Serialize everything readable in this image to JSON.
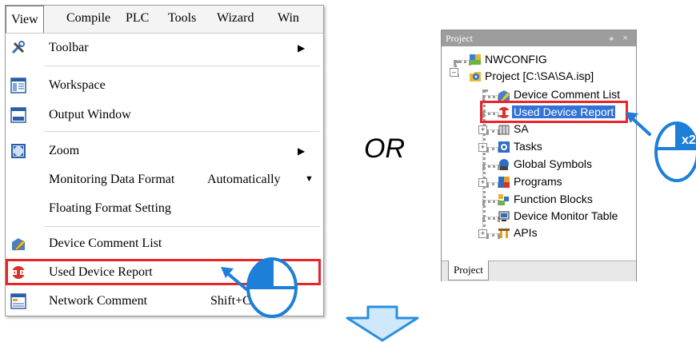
{
  "menubar": {
    "items": [
      "View",
      "Compile",
      "PLC",
      "Tools",
      "Wizard",
      "Win"
    ]
  },
  "menu": {
    "items": [
      {
        "label": "Toolbar",
        "icon": "tools-icon",
        "submenu": true
      },
      {
        "label": "Workspace",
        "icon": "workspace-icon"
      },
      {
        "label": "Output Window",
        "icon": "output-window-icon"
      },
      {
        "label": "Zoom",
        "icon": "zoom-icon",
        "submenu": true
      },
      {
        "label": "Monitoring Data Format",
        "value": "Automatically",
        "dropdown": true
      },
      {
        "label": "Floating Format Setting"
      },
      {
        "label": "Device Comment List",
        "icon": "device-comment-icon"
      },
      {
        "label": "Used Device Report",
        "icon": "used-device-report-icon"
      },
      {
        "label": "Network Comment",
        "icon": "network-comment-icon",
        "shortcut": "Shift+C"
      }
    ]
  },
  "or_text": "OR",
  "project_panel": {
    "title": "Project",
    "header_buttons": "\u0002 ×",
    "tab_label": "Project",
    "tree": [
      {
        "label": "NWCONFIG",
        "icon": "nwconfig-icon"
      },
      {
        "label": "Project [C:\\SA\\SA.isp]",
        "icon": "project-icon"
      },
      {
        "label": "Device Comment List",
        "icon": "device-comment-icon"
      },
      {
        "label": "Used Device Report",
        "icon": "used-device-report-icon",
        "selected": true
      },
      {
        "label": "SA",
        "icon": "plc-icon"
      },
      {
        "label": "Tasks",
        "icon": "tasks-icon"
      },
      {
        "label": "Global Symbols",
        "icon": "global-symbols-icon"
      },
      {
        "label": "Programs",
        "icon": "programs-icon"
      },
      {
        "label": "Function Blocks",
        "icon": "function-blocks-icon"
      },
      {
        "label": "Device Monitor Table",
        "icon": "device-monitor-icon"
      },
      {
        "label": "APIs",
        "icon": "apis-icon"
      }
    ]
  },
  "double_click_badge": "x2",
  "colors": {
    "highlight": "#e8262a",
    "selection": "#3173d6",
    "mouse_blue": "#1e7fd8",
    "arrow_fill": "#cfe8fb",
    "arrow_stroke": "#2a8fdc"
  }
}
